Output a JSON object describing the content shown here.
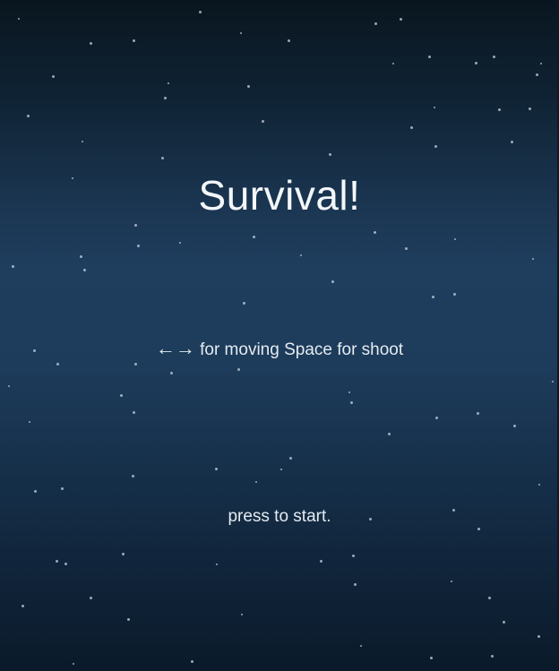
{
  "game": {
    "title": "Survival!",
    "controls": {
      "left_arrow": "←",
      "right_arrow": "→",
      "text": "for moving Space for shoot"
    },
    "start_prompt": "press to start."
  },
  "colors": {
    "sky_top": "#09161f",
    "sky_mid": "#1f3e5e",
    "sky_bottom": "#0a1a29",
    "text": "#f4f7fa",
    "star": "#c9d6e2"
  }
}
